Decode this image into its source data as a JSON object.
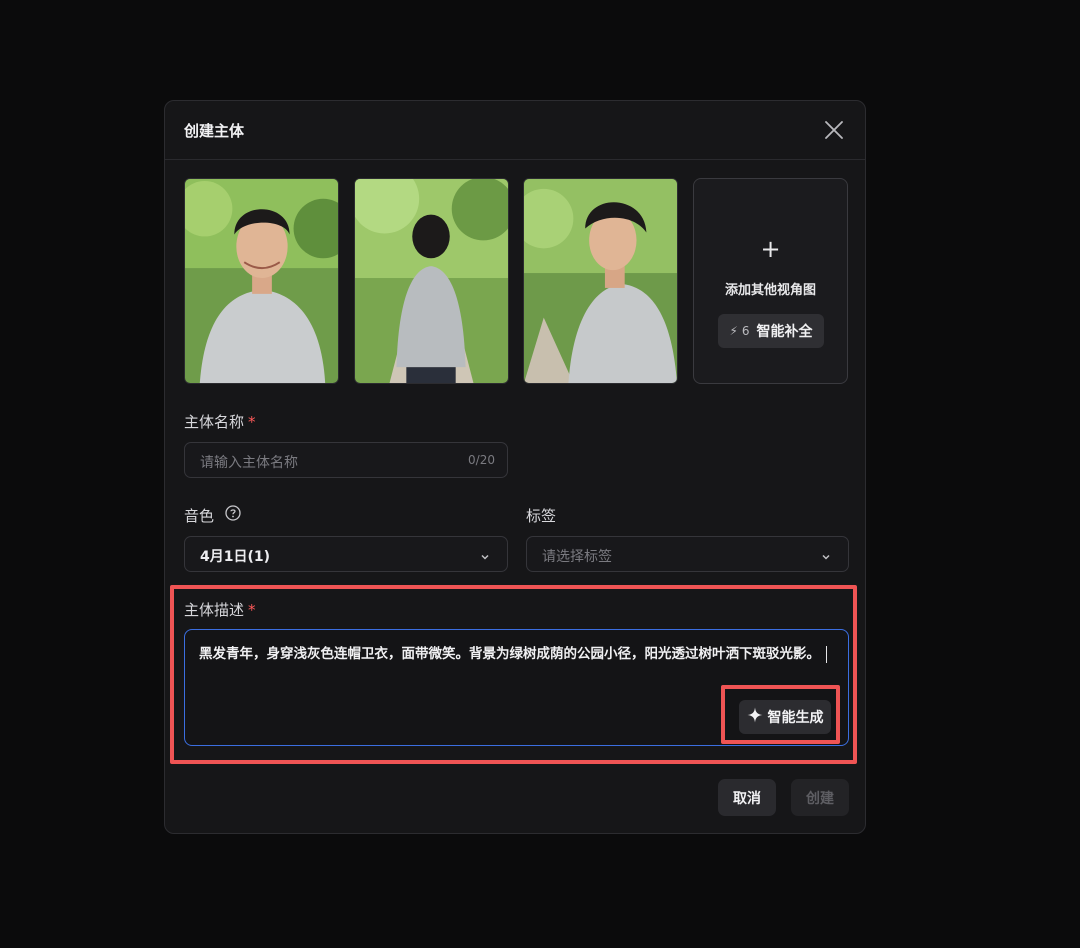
{
  "modal": {
    "title": "创建主体",
    "add_view": {
      "plus": "+",
      "label": "添加其他视角图",
      "smart_fill_count": "6",
      "smart_fill_label": "智能补全"
    },
    "name_field": {
      "label": "主体名称",
      "required_mark": "*",
      "placeholder": "请输入主体名称",
      "counter": "0/20"
    },
    "voice_field": {
      "label": "音色",
      "value": "4月1日(1)"
    },
    "tag_field": {
      "label": "标签",
      "placeholder": "请选择标签"
    },
    "description_field": {
      "label": "主体描述",
      "required_mark": "*",
      "value": "黑发青年，身穿浅灰色连帽卫衣，面带微笑。背景为绿树成荫的公园小径，阳光透过树叶洒下斑驳光影。",
      "generate_label": "智能生成"
    },
    "buttons": {
      "cancel": "取消",
      "create": "创建"
    }
  },
  "colors": {
    "accent_focus": "#3b6ee0",
    "highlight": "#ef5454",
    "required": "#ff5a5a"
  },
  "icons": [
    "close-icon",
    "plus-icon",
    "bolt-icon",
    "help-circle-icon",
    "chevron-down-icon",
    "sparkle-icon"
  ]
}
